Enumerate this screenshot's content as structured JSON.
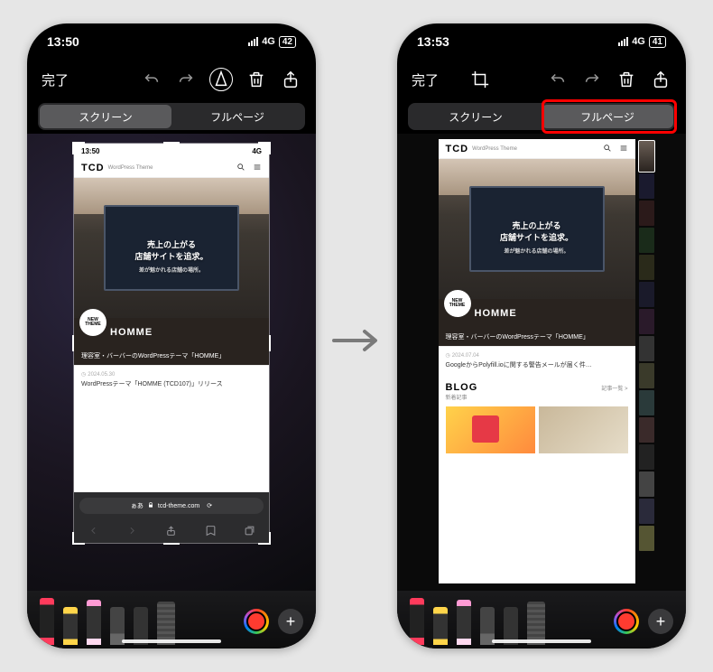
{
  "left": {
    "status": {
      "time": "13:50",
      "net": "4G",
      "battery": "42"
    },
    "toolbar": {
      "done": "完了"
    },
    "tabs": {
      "screen": "スクリーン",
      "fullpage": "フルページ",
      "active": "screen"
    },
    "mini": {
      "status_time": "13:50",
      "status_net": "4G",
      "logo": "TCD",
      "logo_sub": "WordPress Theme",
      "hero_line1": "売上の上がる",
      "hero_line2": "店舗サイトを追求。",
      "hero_sub": "差が魅かれる店舗の場所。",
      "badge_top": "NEW",
      "badge_bot": "THEME",
      "band_title": "HOMME",
      "desc": "理容室・バーバーのWordPressテーマ「HOMME」",
      "article_date": "2024.05.30",
      "article_title": "WordPressテーマ「HOMME (TCD107)」リリース",
      "addr_lang": "ぁあ",
      "addr_url": "tcd-theme.com"
    }
  },
  "right": {
    "status": {
      "time": "13:53",
      "net": "4G",
      "battery": "41"
    },
    "toolbar": {
      "done": "完了"
    },
    "tabs": {
      "screen": "スクリーン",
      "fullpage": "フルページ",
      "active": "fullpage"
    },
    "page": {
      "logo": "TCD",
      "logo_sub": "WordPress Theme",
      "hero_line1": "売上の上がる",
      "hero_line2": "店舗サイトを追求。",
      "hero_sub": "差が魅かれる店舗の場所。",
      "badge_top": "NEW",
      "badge_bot": "THEME",
      "band_title": "HOMME",
      "desc": "理容室・バーバーのWordPressテーマ「HOMME」",
      "article2_date": "2024.07.04",
      "article2_title": "GoogleからPolyfill.ioに関する警告メールが届く件…",
      "blog_title": "BLOG",
      "blog_sub": "新着記事",
      "blog_more": "記事一覧 >"
    }
  }
}
